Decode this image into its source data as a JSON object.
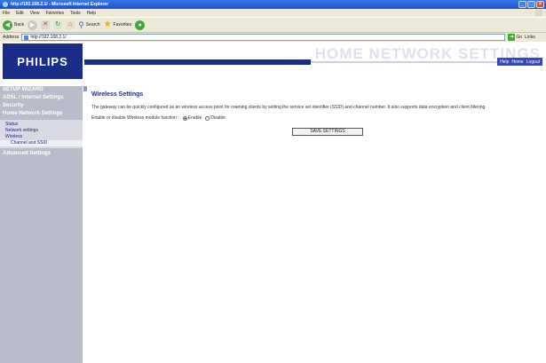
{
  "window": {
    "title": "http://192.168.2.1/ - Microsoft Internet Explorer",
    "buttons": [
      "_",
      "□",
      "×"
    ]
  },
  "menu": [
    "File",
    "Edit",
    "View",
    "Favorites",
    "Tools",
    "Help"
  ],
  "toolbar": {
    "back_label": "Back",
    "search_label": "Search",
    "favorites_label": "Favorites"
  },
  "address": {
    "label": "Address",
    "url": "http://192.168.2.1/",
    "go_label": "Go",
    "links_label": "Links"
  },
  "header": {
    "logo": "PHILIPS",
    "title": "HOME NETWORK SETTINGS",
    "help_label": "Help",
    "home_label": "Home",
    "logout_label": "Logout"
  },
  "sidebar": {
    "items": [
      {
        "label": "SETUP WIZARD"
      },
      {
        "label": "ADSL / Internet Settings"
      },
      {
        "label": "Security"
      },
      {
        "label": "Home Network Settings"
      }
    ],
    "subitems": [
      {
        "label": "Status"
      },
      {
        "label": "Network settings"
      },
      {
        "label": "Wireless"
      },
      {
        "label": "Channel and SSID"
      }
    ],
    "advanced": "Advanced Settings"
  },
  "content": {
    "title": "Wireless Settings",
    "description": "The gateway can be quickly configured as an wireless access point for roaming clients by setting the service set identifier (SSID) and channel number. It also supports data encryption and client filtering.",
    "enable_label": "Enable or disable Wireless module function :",
    "enable_option": "Enable",
    "disable_option": "Disable",
    "save_button": "SAVE SETTINGS"
  }
}
